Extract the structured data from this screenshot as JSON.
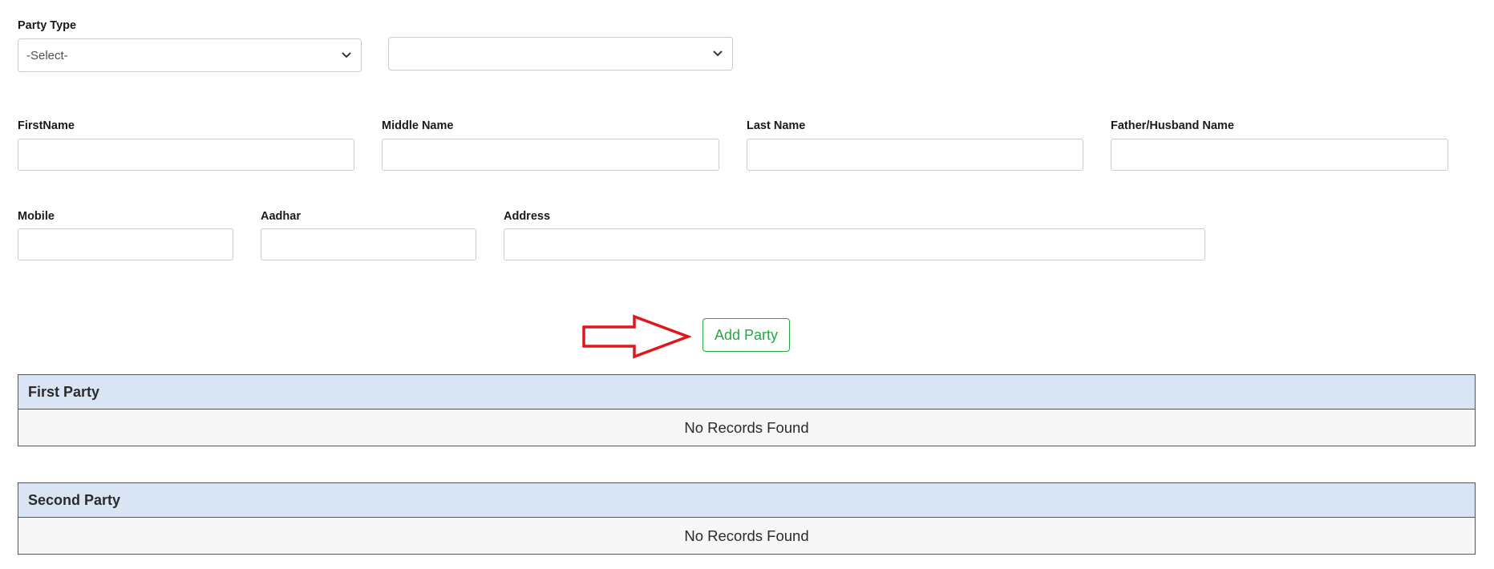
{
  "party_type": {
    "label": "Party Type",
    "selected": "-Select-",
    "secondary_selected": ""
  },
  "names": {
    "first_label": "FirstName",
    "middle_label": "Middle Name",
    "last_label": "Last Name",
    "father_label": "Father/Husband Name",
    "first_value": "",
    "middle_value": "",
    "last_value": "",
    "father_value": ""
  },
  "contact": {
    "mobile_label": "Mobile",
    "aadhar_label": "Aadhar",
    "address_label": "Address",
    "mobile_value": "",
    "aadhar_value": "",
    "address_value": ""
  },
  "actions": {
    "add_party_label": "Add Party"
  },
  "first_party": {
    "title": "First Party",
    "empty_text": "No Records Found"
  },
  "second_party": {
    "title": "Second Party",
    "empty_text": "No Records Found"
  },
  "colors": {
    "accent_green": "#28a745",
    "panel_header": "#d9e4f5",
    "annotation_red": "#e0161d"
  },
  "icons": {
    "dropdown": "chevron-down-icon",
    "annotation": "arrow-right-icon"
  }
}
